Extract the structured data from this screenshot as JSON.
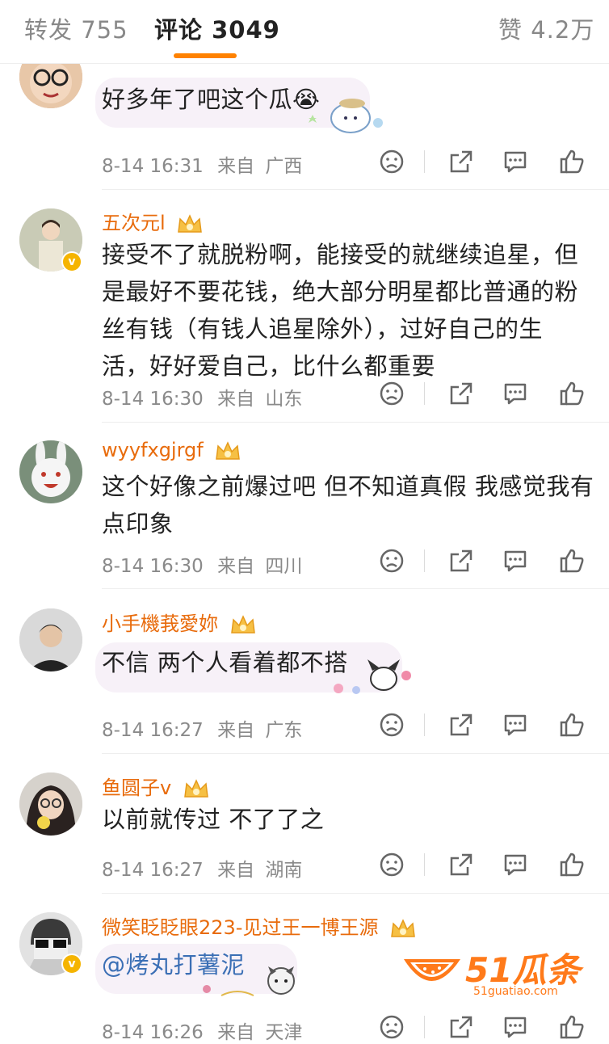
{
  "tabs": {
    "repost": "转发 755",
    "comments": "评论 3049",
    "likes": "赞 4.2万"
  },
  "comments": [
    {
      "text": "好多年了吧这个瓜😭",
      "time": "8-14 16:31",
      "from_label": "来自",
      "location": "广西"
    },
    {
      "name": "五次元l",
      "text": "接受不了就脱粉啊，能接受的就继续追星，但是最好不要花钱，绝大部分明星都比普通的粉丝有钱（有钱人追星除外），过好自己的生活，好好爱自己，比什么都重要",
      "time": "8-14 16:30",
      "from_label": "来自",
      "location": "山东"
    },
    {
      "name": "wyyfxgjrgf",
      "text": "这个好像之前爆过吧 但不知道真假 我感觉我有点印象",
      "time": "8-14 16:30",
      "from_label": "来自",
      "location": "四川"
    },
    {
      "name": "小手機莪愛妳",
      "text": "不信 两个人看着都不搭",
      "time": "8-14 16:27",
      "from_label": "来自",
      "location": "广东"
    },
    {
      "name": "鱼圆子v",
      "text": "以前就传过 不了了之",
      "time": "8-14 16:27",
      "from_label": "来自",
      "location": "湖南"
    },
    {
      "name": "微笑眨眨眼223-见过王一博王源",
      "text": "@烤丸打薯泥",
      "time": "8-14 16:26",
      "from_label": "来自",
      "location": "天津"
    }
  ],
  "watermark": {
    "brand": "51瓜条",
    "url": "51guatiao.com"
  },
  "colors": {
    "accent": "#ff8200",
    "username": "#e86b0c",
    "mention": "#3b6fb5",
    "meta": "#8a8a8a"
  },
  "icons": [
    "dislike-icon",
    "share-icon",
    "comment-icon",
    "like-icon",
    "crown-badge-icon",
    "verified-badge-icon"
  ]
}
